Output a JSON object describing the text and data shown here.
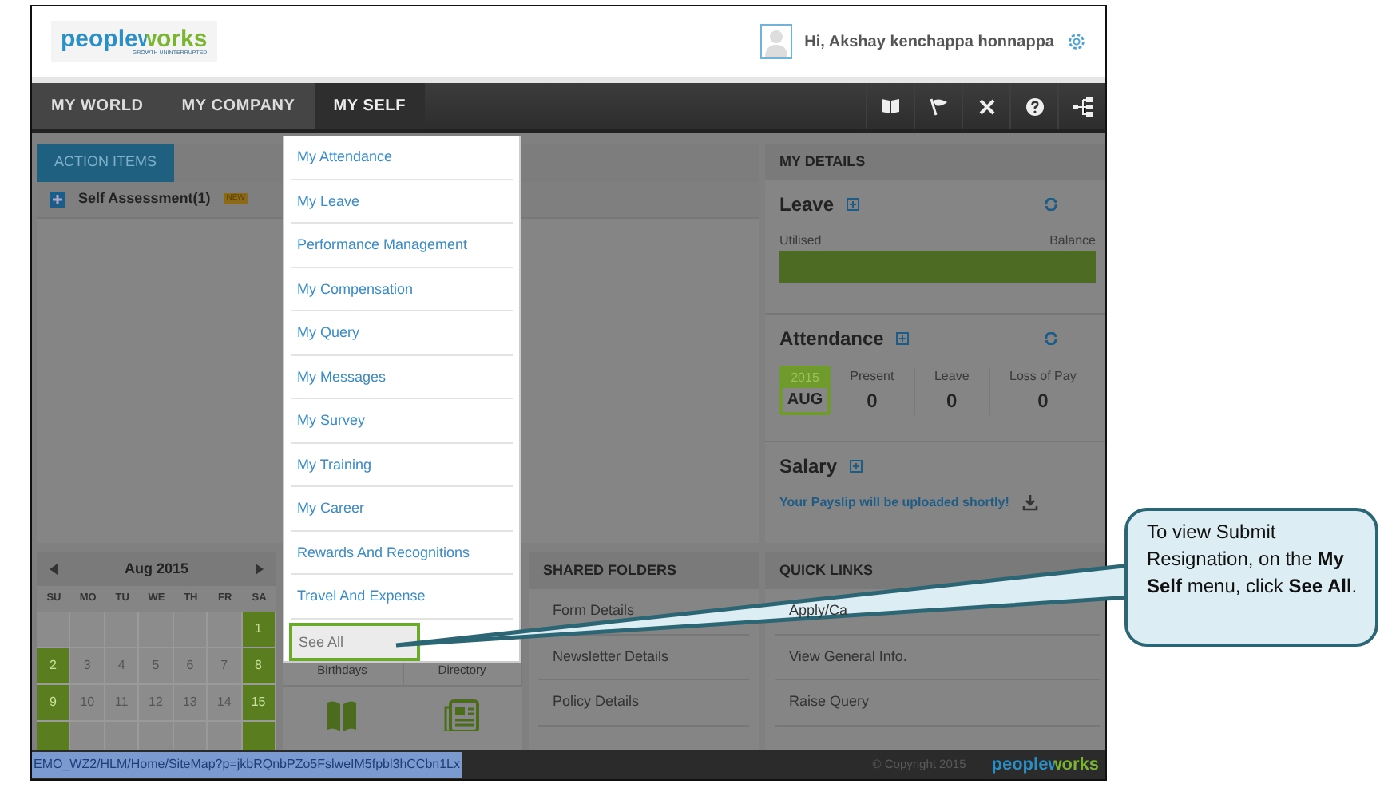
{
  "header": {
    "logo": "peopleworks",
    "tagline": "GROWTH UNINTERRUPTED",
    "greeting": "Hi, Akshay kenchappa honnappa"
  },
  "nav": {
    "tabs": [
      {
        "label": "MY WORLD",
        "selected": false
      },
      {
        "label": "MY COMPANY",
        "selected": false
      },
      {
        "label": "MY SELF",
        "selected": true
      }
    ]
  },
  "menu": {
    "items": [
      {
        "label": "My Attendance",
        "selected": false
      },
      {
        "label": "My Leave",
        "selected": false
      },
      {
        "label": "Performance Management",
        "selected": false
      },
      {
        "label": "My Compensation",
        "selected": false
      },
      {
        "label": "My Query",
        "selected": false
      },
      {
        "label": "My Messages",
        "selected": false
      },
      {
        "label": "My Survey",
        "selected": false
      },
      {
        "label": "My Training",
        "selected": false
      },
      {
        "label": "My Career",
        "selected": false
      },
      {
        "label": "Rewards And Recognitions",
        "selected": false
      },
      {
        "label": "Travel And Expense",
        "selected": false
      },
      {
        "label": "See All",
        "selected": true
      }
    ]
  },
  "action_items": {
    "tabs": [
      {
        "label": "ACTION ITEMS",
        "selected": true
      }
    ],
    "items": [
      {
        "label": "Self Assessment(1)",
        "badge": "NEW"
      }
    ]
  },
  "my_details": {
    "title": "MY DETAILS",
    "leave": {
      "title": "Leave",
      "utilised_label": "Utilised",
      "balance_label": "Balance",
      "level": 1
    },
    "attendance": {
      "title": "Attendance",
      "year": "2015",
      "month": "AUG",
      "stats": [
        {
          "label": "Present",
          "value": "0"
        },
        {
          "label": "Leave",
          "value": "0"
        },
        {
          "label": "Loss of Pay",
          "value": "0"
        }
      ]
    },
    "salary": {
      "title": "Salary",
      "message": "Your Payslip will be uploaded shortly!"
    }
  },
  "calendar": {
    "month": "Aug 2015",
    "weekdays": [
      "SU",
      "MO",
      "TU",
      "WE",
      "TH",
      "FR",
      "SA"
    ],
    "weeks": [
      [
        {
          "weekend": false
        },
        {
          "weekend": false
        },
        {
          "weekend": false
        },
        {
          "weekend": false
        },
        {
          "weekend": false
        },
        {
          "weekend": false
        },
        {
          "day": "1",
          "weekend": true
        }
      ],
      [
        {
          "day": "2",
          "weekend": true
        },
        {
          "day": "3",
          "weekend": false
        },
        {
          "day": "4",
          "weekend": false
        },
        {
          "day": "5",
          "weekend": false
        },
        {
          "day": "6",
          "weekend": false
        },
        {
          "day": "7",
          "weekend": false
        },
        {
          "day": "8",
          "weekend": true
        }
      ],
      [
        {
          "day": "9",
          "weekend": true
        },
        {
          "day": "10",
          "weekend": false
        },
        {
          "day": "11",
          "weekend": false
        },
        {
          "day": "12",
          "weekend": false
        },
        {
          "day": "13",
          "weekend": false
        },
        {
          "day": "14",
          "weekend": false
        },
        {
          "day": "15",
          "weekend": true
        }
      ],
      [
        {
          "weekend": true
        },
        {
          "weekend": false
        },
        {
          "weekend": false
        },
        {
          "weekend": false
        },
        {
          "weekend": false
        },
        {
          "weekend": false
        },
        {
          "weekend": true
        }
      ]
    ]
  },
  "tiles": [
    {
      "label": "Birthdays"
    },
    {
      "label": "Directory"
    }
  ],
  "shared_folders": {
    "title": "SHARED FOLDERS",
    "items": [
      "Form Details",
      "Newsletter Details",
      "Policy Details"
    ]
  },
  "quick_links": {
    "title": "QUICK LINKS",
    "items": [
      "Apply/Ca",
      "View General Info.",
      "Raise Query"
    ]
  },
  "status_bar": {
    "url": "EMO_WZ2/HLM/Home/SiteMap?p=jkbRQnbPZo5FslweIM5fpbl3hCCbn1Lx",
    "copyright": "© Copyright 2015",
    "logo": "peopleworks"
  },
  "callout": {
    "text": "To view Submit Resignation, on the **My Self** menu, click **See All**."
  }
}
